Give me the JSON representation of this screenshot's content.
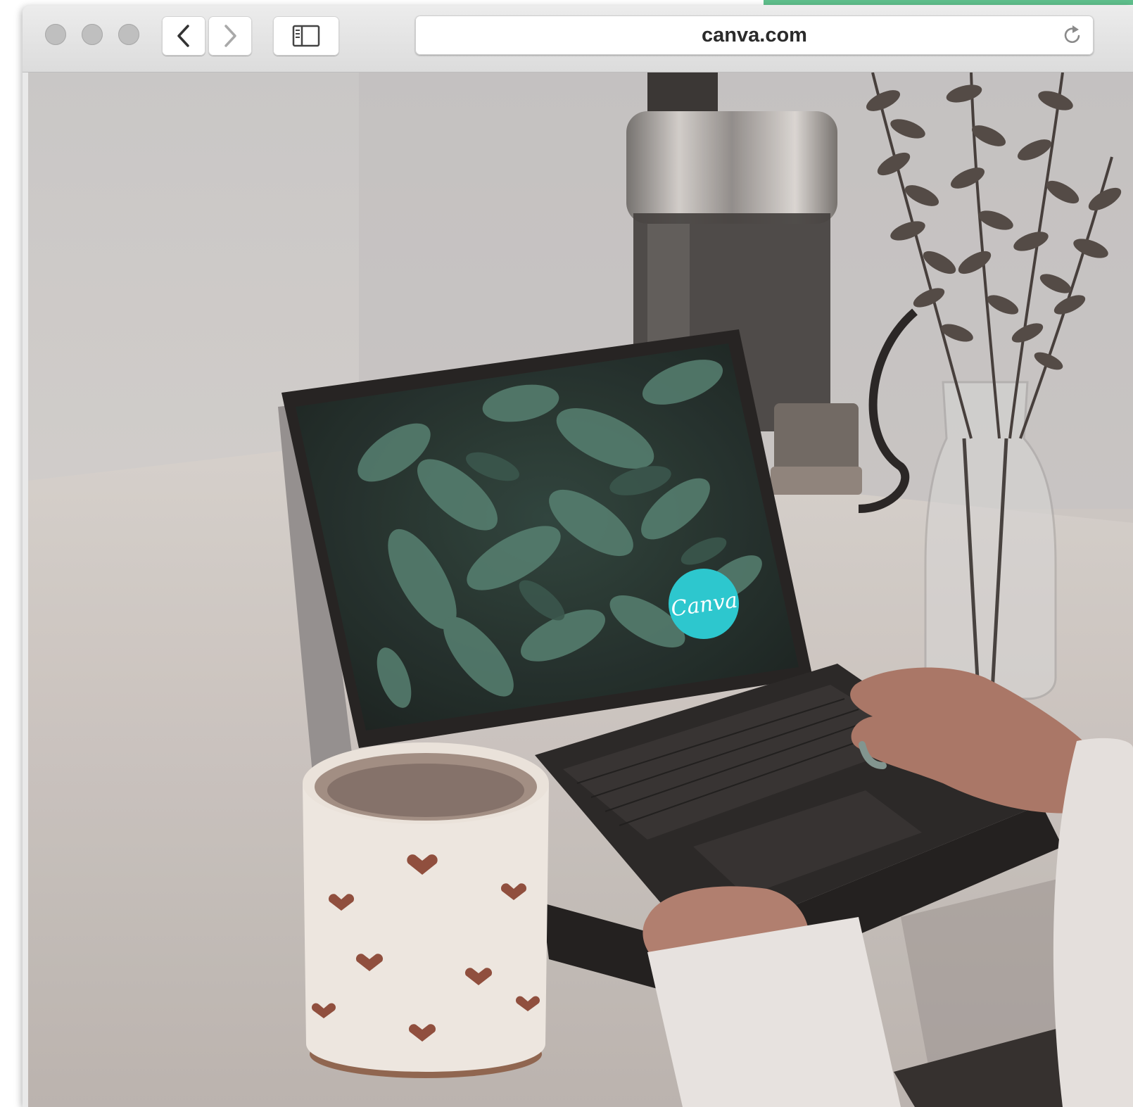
{
  "browser": {
    "url": "canva.com",
    "icons": {
      "back": "chevron-left-icon",
      "forward": "chevron-right-icon",
      "sidebar": "sidebar-icon",
      "reload": "reload-icon"
    }
  },
  "page": {
    "logo_text": "Canva"
  },
  "colors": {
    "accent_strip": "#5fbf8c",
    "canva_logo": "#20c4cb"
  }
}
